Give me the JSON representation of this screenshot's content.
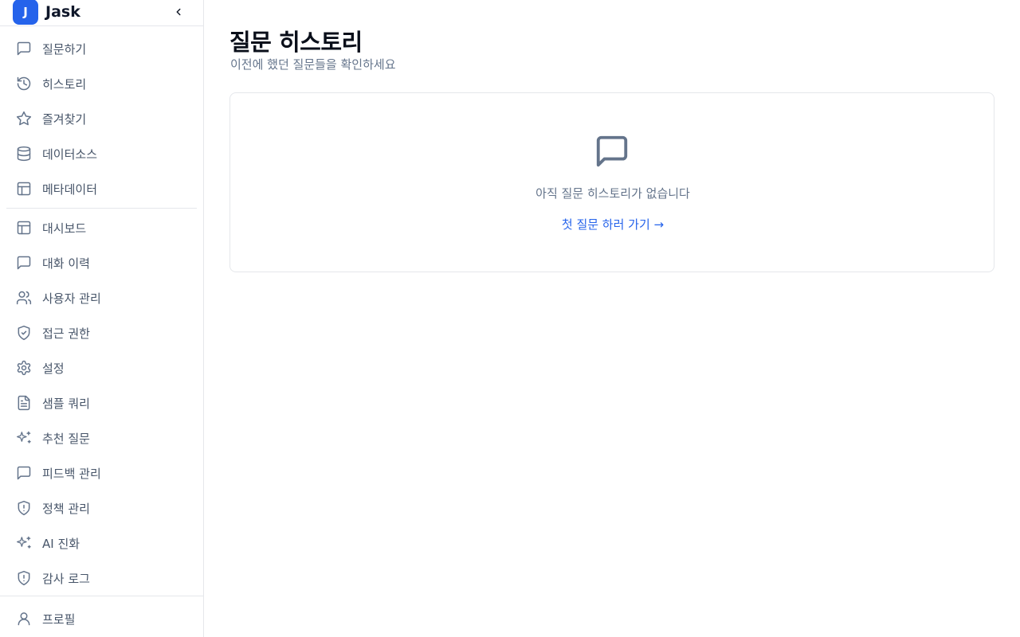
{
  "brand": {
    "logo_letter": "J",
    "name": "Jask",
    "collapse_icon": "chevron-left-icon"
  },
  "sidebar": {
    "primary": [
      {
        "label": "질문하기",
        "icon": "message-square-icon"
      },
      {
        "label": "히스토리",
        "icon": "history-icon"
      },
      {
        "label": "즐겨찾기",
        "icon": "star-icon"
      },
      {
        "label": "데이터소스",
        "icon": "database-icon"
      },
      {
        "label": "메타데이터",
        "icon": "layout-icon"
      }
    ],
    "admin": [
      {
        "label": "대시보드",
        "icon": "layout-icon"
      },
      {
        "label": "대화 이력",
        "icon": "message-square-icon"
      },
      {
        "label": "사용자 관리",
        "icon": "users-icon"
      },
      {
        "label": "접근 권한",
        "icon": "shield-check-icon"
      },
      {
        "label": "설정",
        "icon": "gear-icon"
      },
      {
        "label": "샘플 쿼리",
        "icon": "file-text-icon"
      },
      {
        "label": "추천 질문",
        "icon": "sparkles-icon"
      },
      {
        "label": "피드백 관리",
        "icon": "message-square-icon"
      },
      {
        "label": "정책 관리",
        "icon": "shield-alert-icon"
      },
      {
        "label": "AI 진화",
        "icon": "sparkles-icon"
      },
      {
        "label": "감사 로그",
        "icon": "shield-alert-icon"
      }
    ],
    "profile": {
      "label": "프로필",
      "icon": "user-icon"
    }
  },
  "main": {
    "title": "질문 히스토리",
    "subtitle": "이전에 했던 질문들을 확인하세요",
    "empty_state": {
      "icon": "message-square-icon",
      "message": "아직 질문 히스토리가 없습니다",
      "cta": "첫 질문 하러 가기 →"
    }
  },
  "colors": {
    "accent": "#2563eb",
    "muted": "#64748b",
    "border": "#e5e7eb"
  }
}
